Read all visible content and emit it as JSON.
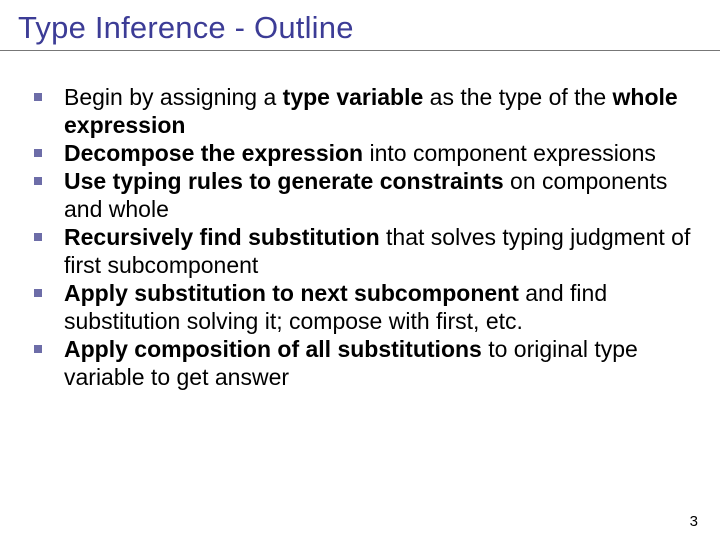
{
  "title": "Type Inference - Outline",
  "bullets": [
    {
      "html": "Begin by assigning a <b>type variable</b> as the type of the <b>whole expression</b>"
    },
    {
      "html": "<b>Decompose the expression</b> into component expressions"
    },
    {
      "html": "<b>Use typing rules to generate constraints</b> on components and whole"
    },
    {
      "html": "<b>Recursively find substitution</b> that solves typing judgment of first subcomponent"
    },
    {
      "html": "<b>Apply substitution to next subcomponent</b> and find substitution solving it; compose with first, etc."
    },
    {
      "html": "<b>Apply composition of all substitutions</b> to original type variable to get answer"
    }
  ],
  "pageNumber": "3"
}
